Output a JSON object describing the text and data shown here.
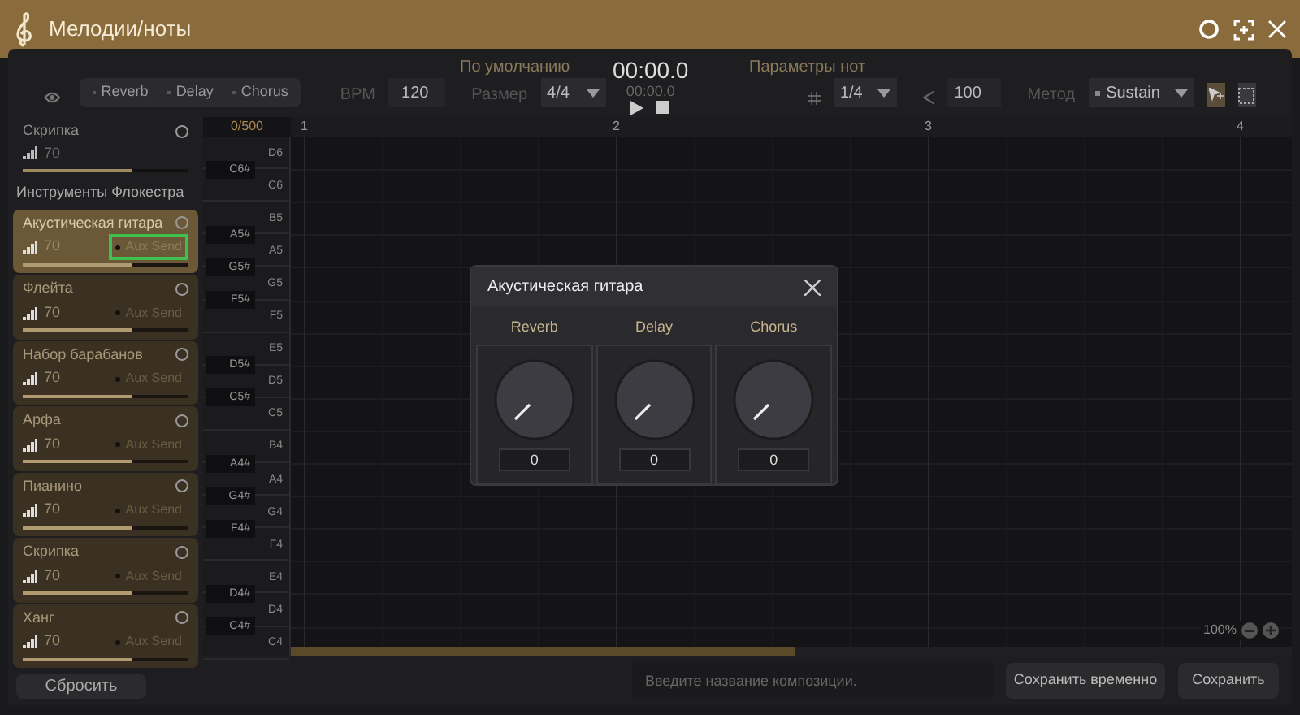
{
  "window": {
    "title": "Мелодии/ноты"
  },
  "toolbar": {
    "effects": [
      "Reverb",
      "Delay",
      "Chorus"
    ],
    "bpm_label": "BPM",
    "bpm": "120",
    "size_label": "Размер",
    "size": "4/4",
    "preset": "По умолчанию",
    "time": "00:00.0",
    "time_small": "00:00.0",
    "note_params_label": "Параметры нот",
    "grid": "1/4",
    "velocity": "100",
    "method_label": "Метод",
    "method": "Sustain"
  },
  "current_instrument": {
    "name": "Скрипка",
    "volume": "70",
    "level": 0.66
  },
  "section_title": "Инструменты Флокестра",
  "instruments": [
    {
      "name": "Акустическая гитара",
      "volume": "70",
      "level": 0.66,
      "aux": "Aux Send",
      "selected": true,
      "highlighted": true
    },
    {
      "name": "Флейта",
      "volume": "70",
      "level": 0.66,
      "aux": "Aux Send",
      "selected": false,
      "highlighted": false
    },
    {
      "name": "Набор барабанов",
      "volume": "70",
      "level": 0.66,
      "aux": "Aux Send",
      "selected": false,
      "highlighted": false
    },
    {
      "name": "Арфа",
      "volume": "70",
      "level": 0.66,
      "aux": "Aux Send",
      "selected": false,
      "highlighted": false
    },
    {
      "name": "Пианино",
      "volume": "70",
      "level": 0.66,
      "aux": "Aux Send",
      "selected": false,
      "highlighted": false
    },
    {
      "name": "Скрипка",
      "volume": "70",
      "level": 0.66,
      "aux": "Aux Send",
      "selected": false,
      "highlighted": false
    },
    {
      "name": "Ханг",
      "volume": "70",
      "level": 0.66,
      "aux": "Aux Send",
      "selected": false,
      "highlighted": false
    }
  ],
  "reset": "Сбросить",
  "piano": {
    "counter": "0/500",
    "keys": [
      {
        "label": "D6",
        "kind": "white"
      },
      {
        "label": "C6#",
        "kind": "black"
      },
      {
        "label": "C6",
        "kind": "white"
      },
      {
        "label": "B5",
        "kind": "white"
      },
      {
        "label": "A5#",
        "kind": "black"
      },
      {
        "label": "A5",
        "kind": "white"
      },
      {
        "label": "G5#",
        "kind": "black"
      },
      {
        "label": "G5",
        "kind": "white"
      },
      {
        "label": "F5#",
        "kind": "black"
      },
      {
        "label": "F5",
        "kind": "white"
      },
      {
        "label": "E5",
        "kind": "white"
      },
      {
        "label": "D5#",
        "kind": "black"
      },
      {
        "label": "D5",
        "kind": "white"
      },
      {
        "label": "C5#",
        "kind": "black"
      },
      {
        "label": "C5",
        "kind": "white"
      },
      {
        "label": "B4",
        "kind": "white"
      },
      {
        "label": "A4#",
        "kind": "black"
      },
      {
        "label": "A4",
        "kind": "white"
      },
      {
        "label": "G4#",
        "kind": "black"
      },
      {
        "label": "G4",
        "kind": "white"
      },
      {
        "label": "F4#",
        "kind": "black"
      },
      {
        "label": "F4",
        "kind": "white"
      },
      {
        "label": "E4",
        "kind": "white"
      },
      {
        "label": "D4#",
        "kind": "black"
      },
      {
        "label": "D4",
        "kind": "white"
      },
      {
        "label": "C4#",
        "kind": "black"
      },
      {
        "label": "C4",
        "kind": "white"
      }
    ]
  },
  "ruler": [
    "1",
    "2",
    "3",
    "4"
  ],
  "zoom": "100%",
  "dialog": {
    "title": "Акустическая гитара",
    "knobs": [
      {
        "label": "Reverb",
        "value": "0"
      },
      {
        "label": "Delay",
        "value": "0"
      },
      {
        "label": "Chorus",
        "value": "0"
      }
    ]
  },
  "footer": {
    "name_placeholder": "Введите название композиции.",
    "save_temp": "Сохранить временно",
    "save": "Сохранить"
  }
}
